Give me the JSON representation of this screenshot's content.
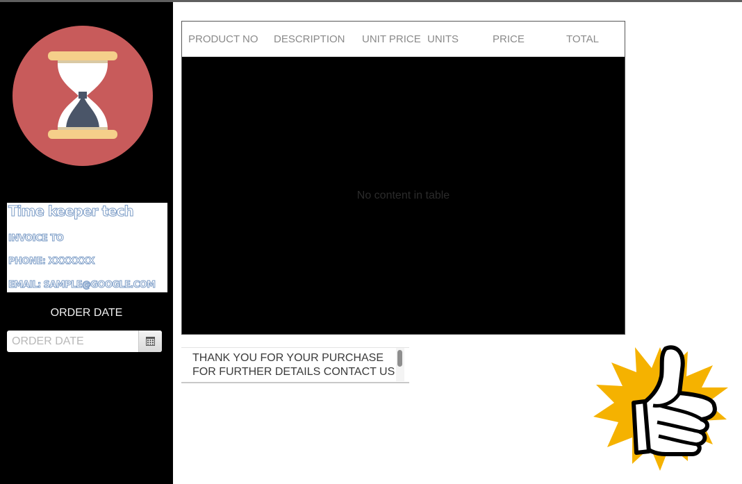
{
  "sidebar": {
    "logo_icon": "hourglass-icon",
    "company_name": "Time keeper tech",
    "invoice_to": "INVOICE TO",
    "phone": "PHONE: XXXXXXX",
    "email": "EMAIL: SAMPLE@GOOGLE.COM",
    "order_date_label": "ORDER DATE",
    "order_date_placeholder": "ORDER DATE",
    "calendar_icon": "calendar-icon"
  },
  "table": {
    "columns": [
      "PRODUCT NO",
      "DESCRIPTION",
      "UNIT PRICE",
      "UNITS",
      "PRICE",
      "TOTAL"
    ],
    "empty_message": "No content in table"
  },
  "message": {
    "line1": "THANK YOU FOR YOUR PURCHASE",
    "line2": "FOR FURTHER DETAILS CONTACT US"
  },
  "decoration": {
    "icon": "thumbs-up-icon"
  },
  "colors": {
    "sidebar_bg": "#000000",
    "logo_circle": "#c85b5b",
    "hourglass_frame": "#f5cf8a",
    "outline_text": "#7a9bc6",
    "burst": "#f5b200"
  }
}
